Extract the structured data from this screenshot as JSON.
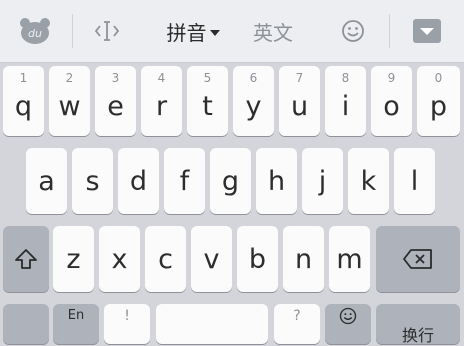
{
  "toolbar": {
    "logo_text": "du",
    "cursor_icon": "text-cursor-icon",
    "pinyin_label": "拼音",
    "english_label": "英文",
    "emoji_icon": "smiley-icon",
    "collapse_icon": "collapse-down-icon"
  },
  "rows": {
    "row1": [
      {
        "hint": "1",
        "key": "q"
      },
      {
        "hint": "2",
        "key": "w"
      },
      {
        "hint": "3",
        "key": "e"
      },
      {
        "hint": "4",
        "key": "r"
      },
      {
        "hint": "5",
        "key": "t"
      },
      {
        "hint": "6",
        "key": "y"
      },
      {
        "hint": "7",
        "key": "u"
      },
      {
        "hint": "8",
        "key": "i"
      },
      {
        "hint": "9",
        "key": "o"
      },
      {
        "hint": "0",
        "key": "p"
      }
    ],
    "row2": [
      "a",
      "s",
      "d",
      "f",
      "g",
      "h",
      "j",
      "k",
      "l"
    ],
    "row3": [
      "z",
      "x",
      "c",
      "v",
      "b",
      "n",
      "m"
    ]
  },
  "bottom": {
    "en_label": "En",
    "exclaim_label": "!",
    "question_label": "?",
    "return_label": "换行"
  },
  "colors": {
    "background": "#d3d5da",
    "key": "#fbfbfc",
    "function_key": "#aeb3bb",
    "toolbar": "#eceef1"
  }
}
